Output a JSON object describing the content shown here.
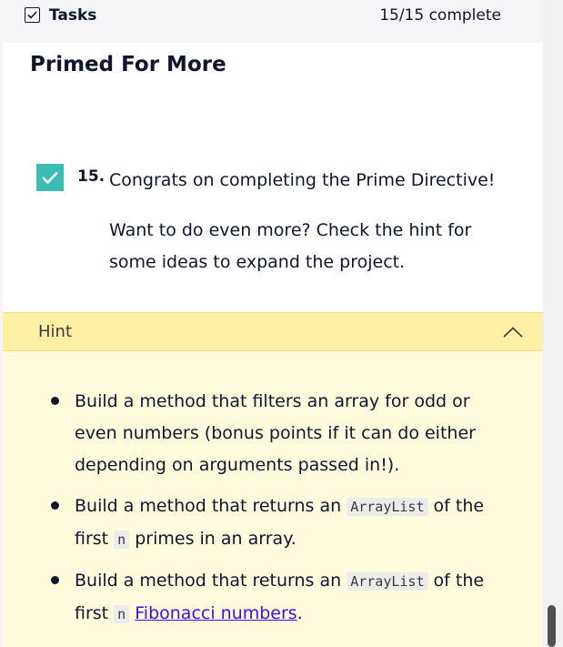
{
  "header": {
    "title": "Tasks",
    "progress": "15/15 complete"
  },
  "section": {
    "title": "Primed For More"
  },
  "task": {
    "number": "15.",
    "completed": true,
    "text": "Congrats on completing the Prime Directive!",
    "subtext": "Want to do even more? Check the hint for some ideas to expand the project."
  },
  "hint": {
    "label": "Hint",
    "expanded": true,
    "items": [
      {
        "text": "Build a method that filters an array for odd or even numbers (bonus points if it can do either depending on arguments passed in!)."
      },
      {
        "part1": "Build a method that returns an ",
        "code1": "ArrayList",
        "part2": " of the first ",
        "code2": "n",
        "part3": " primes in an array."
      },
      {
        "part1": "Build a method that returns an ",
        "code1": "ArrayList",
        "part2": " of the first ",
        "code2": "n",
        "link": "Fibonacci numbers",
        "part3": "."
      }
    ]
  },
  "colors": {
    "accent": "#3cbcb4",
    "hint_header": "#fff0a6",
    "hint_body": "#fffbdc",
    "link": "#3a10e5",
    "text": "#10162f"
  }
}
